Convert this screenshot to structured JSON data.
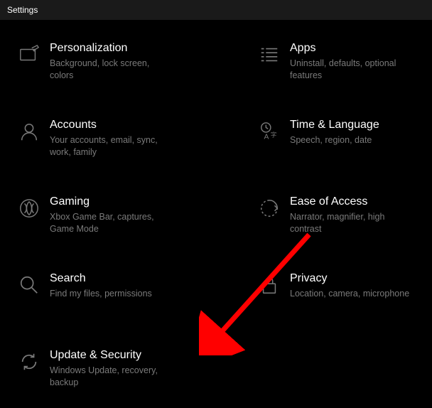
{
  "window": {
    "title": "Settings"
  },
  "tiles": [
    {
      "title": "Personalization",
      "desc": "Background, lock screen, colors"
    },
    {
      "title": "Apps",
      "desc": "Uninstall, defaults, optional features"
    },
    {
      "title": "Accounts",
      "desc": "Your accounts, email, sync, work, family"
    },
    {
      "title": "Time & Language",
      "desc": "Speech, region, date"
    },
    {
      "title": "Gaming",
      "desc": "Xbox Game Bar, captures, Game Mode"
    },
    {
      "title": "Ease of Access",
      "desc": "Narrator, magnifier, high contrast"
    },
    {
      "title": "Search",
      "desc": "Find my files, permissions"
    },
    {
      "title": "Privacy",
      "desc": "Location, camera, microphone"
    },
    {
      "title": "Update & Security",
      "desc": "Windows Update, recovery, backup"
    }
  ]
}
